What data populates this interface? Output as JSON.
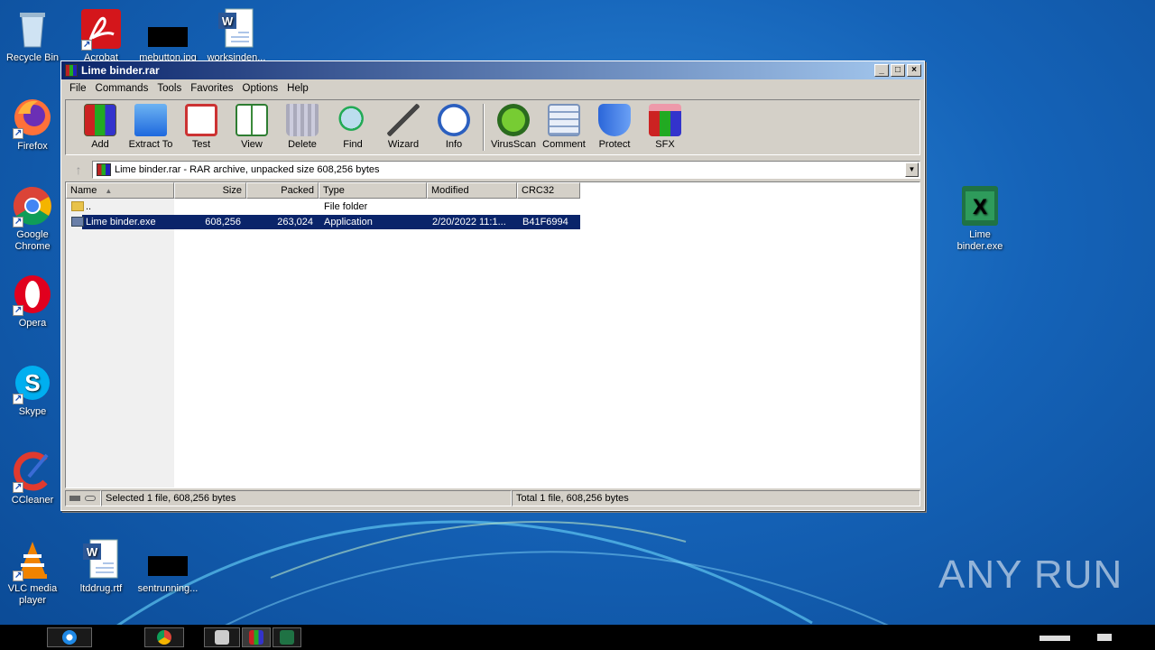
{
  "desktop": {
    "icons_left": [
      {
        "label": "Recycle Bin",
        "icon": "recycle-bin-icon"
      },
      {
        "label": "Firefox",
        "icon": "firefox-icon"
      },
      {
        "label": "Google Chrome",
        "icon": "chrome-icon"
      },
      {
        "label": "Opera",
        "icon": "opera-icon"
      },
      {
        "label": "Skype",
        "icon": "skype-icon"
      },
      {
        "label": "CCleaner",
        "icon": "ccleaner-icon"
      },
      {
        "label": "VLC media player",
        "icon": "vlc-icon"
      }
    ],
    "icons_top": [
      {
        "label": "Acrobat",
        "icon": "acrobat-icon"
      },
      {
        "label": "mebutton.jpg",
        "icon": "image-file-icon"
      },
      {
        "label": "worksinden...",
        "icon": "word-doc-icon"
      }
    ],
    "icons_bottom": [
      {
        "label": "ltddrug.rtf",
        "icon": "word-doc-icon"
      },
      {
        "label": "sentrunning...",
        "icon": "image-file-icon"
      }
    ],
    "icon_right": {
      "label": "Lime binder.exe",
      "icon": "excel-icon"
    },
    "watermark": "ANY RUN"
  },
  "window": {
    "title": "Lime binder.rar",
    "menu": [
      "File",
      "Commands",
      "Tools",
      "Favorites",
      "Options",
      "Help"
    ],
    "toolbar": [
      {
        "label": "Add",
        "icon": "add-archive-icon"
      },
      {
        "label": "Extract To",
        "icon": "extract-folder-icon"
      },
      {
        "label": "Test",
        "icon": "test-clipboard-icon"
      },
      {
        "label": "View",
        "icon": "view-book-icon"
      },
      {
        "label": "Delete",
        "icon": "trash-icon"
      },
      {
        "label": "Find",
        "icon": "magnifier-icon"
      },
      {
        "label": "Wizard",
        "icon": "wand-icon"
      },
      {
        "label": "Info",
        "icon": "info-icon"
      },
      {
        "label": "VirusScan",
        "icon": "bug-icon"
      },
      {
        "label": "Comment",
        "icon": "comment-icon"
      },
      {
        "label": "Protect",
        "icon": "shield-icon"
      },
      {
        "label": "SFX",
        "icon": "sfx-box-icon"
      }
    ],
    "address": "Lime binder.rar - RAR archive, unpacked size 608,256 bytes",
    "columns": [
      "Name",
      "Size",
      "Packed",
      "Type",
      "Modified",
      "CRC32"
    ],
    "rows": [
      {
        "name": "..",
        "size": "",
        "packed": "",
        "type": "File folder",
        "modified": "",
        "crc": ""
      },
      {
        "name": "Lime binder.exe",
        "size": "608,256",
        "packed": "263,024",
        "type": "Application",
        "modified": "2/20/2022 11:1...",
        "crc": "B41F6994"
      }
    ],
    "status_left": "Selected 1 file, 608,256 bytes",
    "status_right": "Total 1 file, 608,256 bytes"
  },
  "colors": {
    "titlebar": "#0a246a",
    "selection": "#0a246a",
    "chrome": "#d4d0c8"
  }
}
